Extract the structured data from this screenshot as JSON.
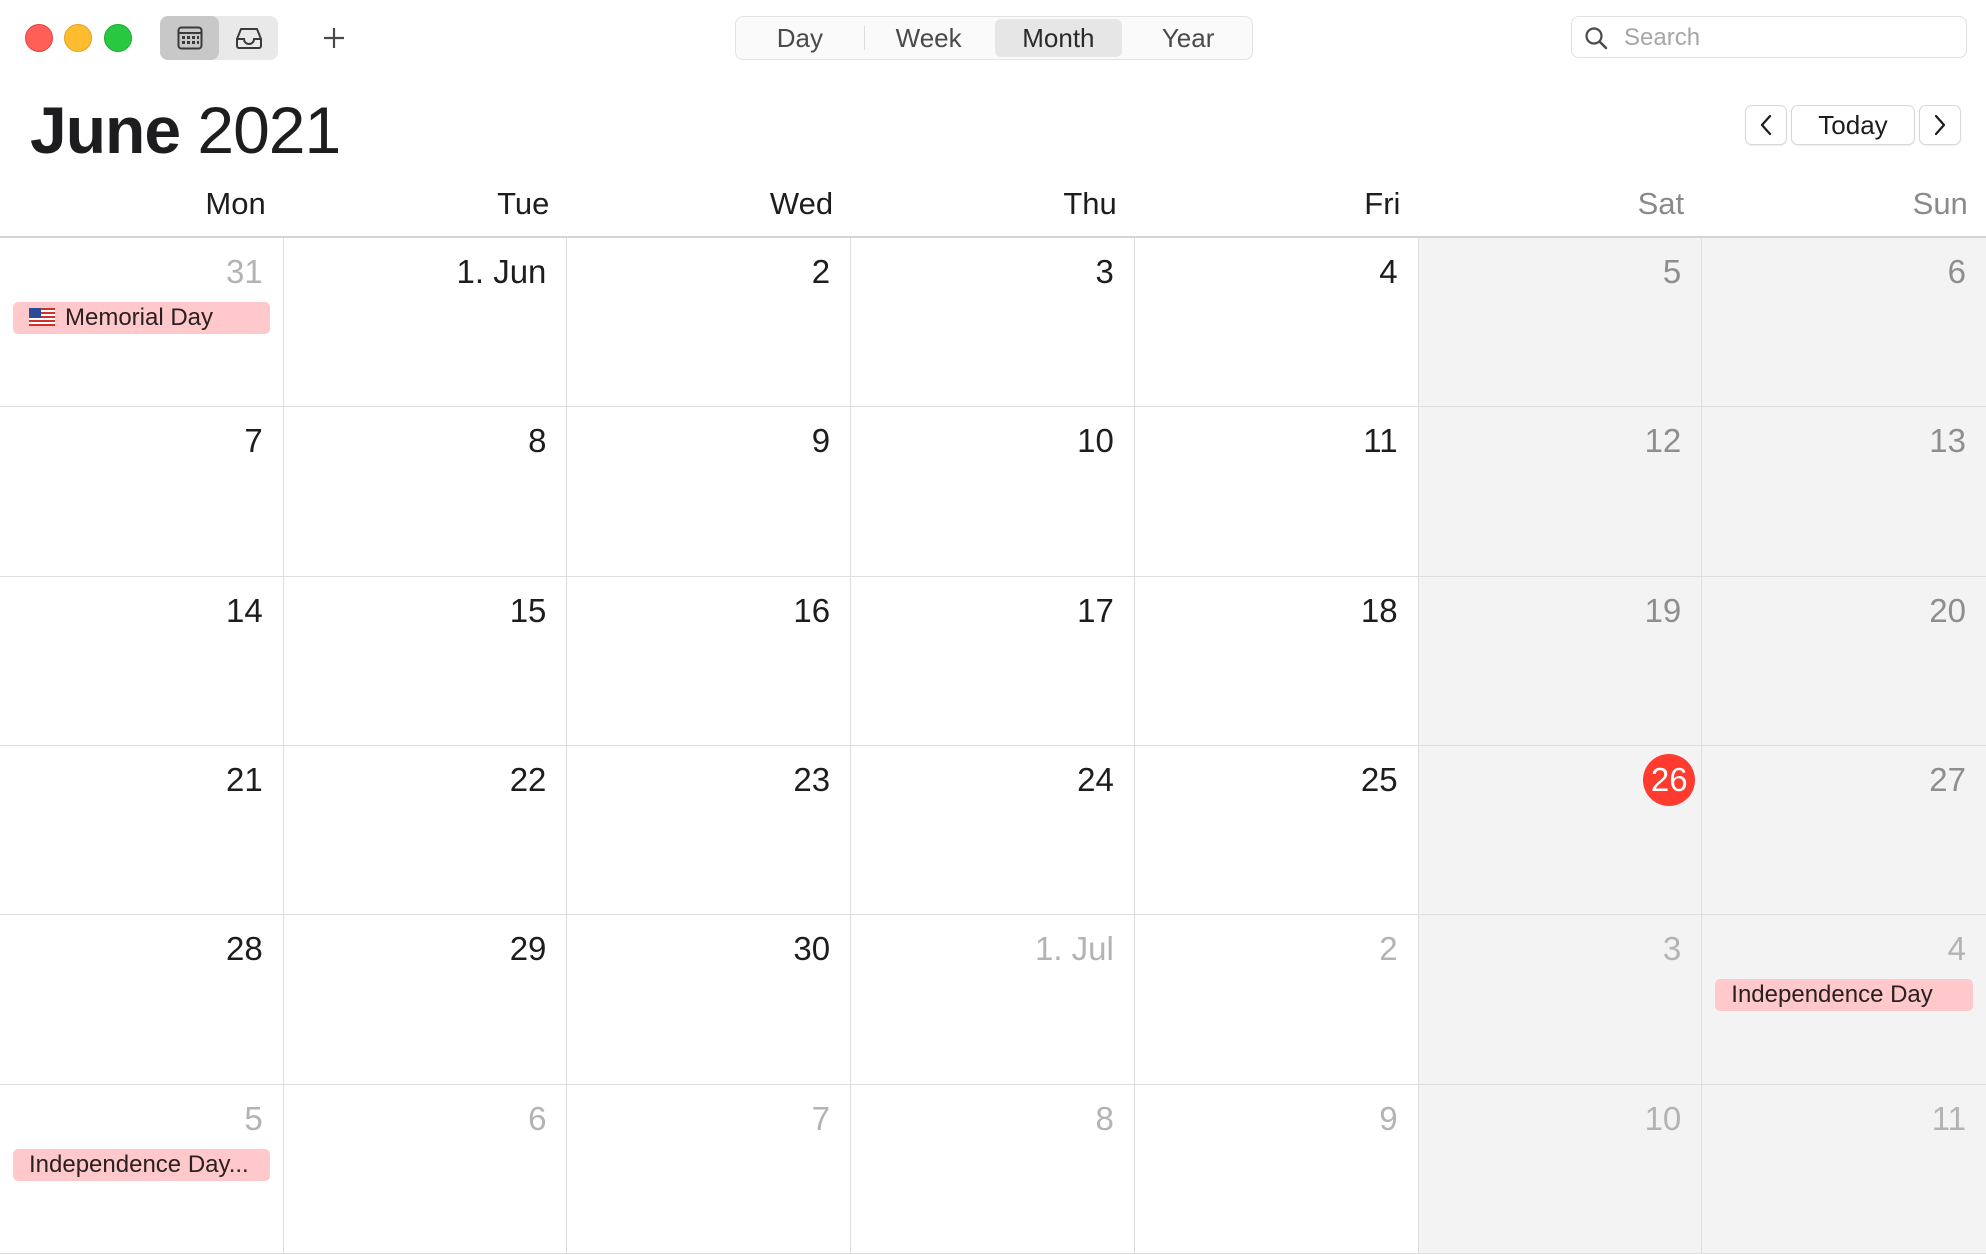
{
  "toolbar": {
    "view_modes": [
      {
        "label": "Day",
        "active": false
      },
      {
        "label": "Week",
        "active": false
      },
      {
        "label": "Month",
        "active": true
      },
      {
        "label": "Year",
        "active": false
      }
    ],
    "search_placeholder": "Search",
    "add_icon": "plus-icon",
    "calendar_icon": "calendar-grid-icon",
    "inbox_icon": "inbox-tray-icon"
  },
  "header": {
    "month": "June",
    "year": "2021",
    "today_label": "Today",
    "prev_icon": "chevron-left-icon",
    "next_icon": "chevron-right-icon"
  },
  "weekdays": [
    {
      "label": "Mon",
      "weekend": false
    },
    {
      "label": "Tue",
      "weekend": false
    },
    {
      "label": "Wed",
      "weekend": false
    },
    {
      "label": "Thu",
      "weekend": false
    },
    {
      "label": "Fri",
      "weekend": false
    },
    {
      "label": "Sat",
      "weekend": true
    },
    {
      "label": "Sun",
      "weekend": true
    }
  ],
  "weeks": [
    [
      {
        "label": "31",
        "other": true,
        "events": [
          {
            "title": "Memorial Day",
            "flag": true
          }
        ]
      },
      {
        "label": "1. Jun"
      },
      {
        "label": "2"
      },
      {
        "label": "3"
      },
      {
        "label": "4"
      },
      {
        "label": "5"
      },
      {
        "label": "6"
      }
    ],
    [
      {
        "label": "7"
      },
      {
        "label": "8"
      },
      {
        "label": "9"
      },
      {
        "label": "10"
      },
      {
        "label": "11"
      },
      {
        "label": "12"
      },
      {
        "label": "13"
      }
    ],
    [
      {
        "label": "14"
      },
      {
        "label": "15"
      },
      {
        "label": "16"
      },
      {
        "label": "17"
      },
      {
        "label": "18"
      },
      {
        "label": "19"
      },
      {
        "label": "20"
      }
    ],
    [
      {
        "label": "21"
      },
      {
        "label": "22"
      },
      {
        "label": "23"
      },
      {
        "label": "24"
      },
      {
        "label": "25"
      },
      {
        "label": "26",
        "today": true
      },
      {
        "label": "27"
      }
    ],
    [
      {
        "label": "28"
      },
      {
        "label": "29"
      },
      {
        "label": "30"
      },
      {
        "label": "1. Jul",
        "other": true
      },
      {
        "label": "2",
        "other": true
      },
      {
        "label": "3",
        "other": true
      },
      {
        "label": "4",
        "other": true,
        "events": [
          {
            "title": "Independence Day"
          }
        ]
      }
    ],
    [
      {
        "label": "5",
        "other": true,
        "events": [
          {
            "title": "Independence Day..."
          }
        ]
      },
      {
        "label": "6",
        "other": true
      },
      {
        "label": "7",
        "other": true
      },
      {
        "label": "8",
        "other": true
      },
      {
        "label": "9",
        "other": true
      },
      {
        "label": "10",
        "other": true
      },
      {
        "label": "11",
        "other": true
      }
    ]
  ],
  "colors": {
    "today": "#ff3b30",
    "event_bg": "#ffc9cc",
    "weekend_bg": "#f3f3f3"
  }
}
